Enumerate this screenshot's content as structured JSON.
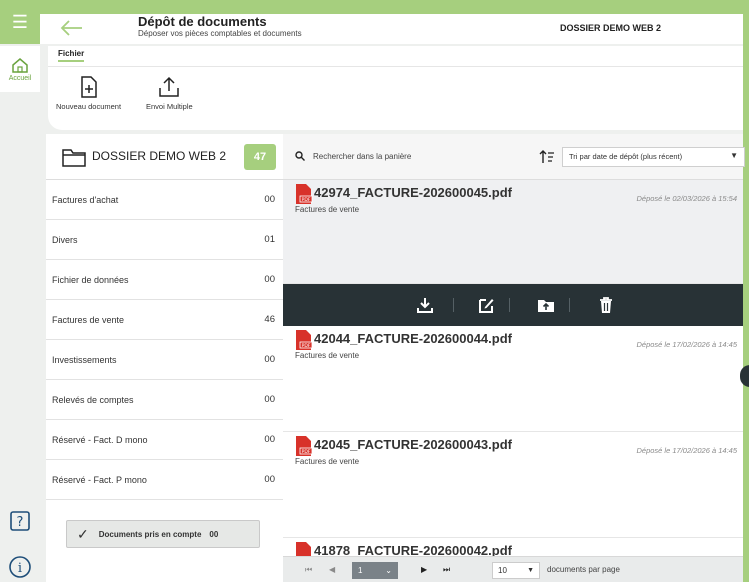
{
  "nav": {
    "home_label": "Accueil"
  },
  "header": {
    "title": "Dépôt de documents",
    "subtitle": "Déposer vos pièces comptables et documents",
    "folder": "DOSSIER DEMO WEB 2"
  },
  "ribbon": {
    "tab": "Fichier",
    "new_doc": "Nouveau document",
    "multi_upload": "Envoi Multiple"
  },
  "folder_panel": {
    "name": "DOSSIER DEMO WEB 2",
    "count": "47",
    "categories": [
      {
        "label": "Factures d'achat",
        "count": "00"
      },
      {
        "label": "Divers",
        "count": "01"
      },
      {
        "label": "Fichier de données",
        "count": "00"
      },
      {
        "label": "Factures de vente",
        "count": "46"
      },
      {
        "label": "Investissements",
        "count": "00"
      },
      {
        "label": "Relevés de comptes",
        "count": "00"
      },
      {
        "label": "Réservé - Fact. D mono",
        "count": "00"
      },
      {
        "label": "Réservé - Fact. P mono",
        "count": "00"
      }
    ],
    "taken_label": "Documents pris en compte",
    "taken_count": "00"
  },
  "docs": {
    "search": "Rechercher dans la panière",
    "sort": "Tri par date de dépôt (plus récent)",
    "items": [
      {
        "name": "42974_FACTURE-202600045.pdf",
        "category": "Factures de vente",
        "date": "Déposé le 02/03/2026 à 15:54"
      },
      {
        "name": "42044_FACTURE-202600044.pdf",
        "category": "Factures de vente",
        "date": "Déposé le 17/02/2026 à 14:45"
      },
      {
        "name": "42045_FACTURE-202600043.pdf",
        "category": "Factures de vente",
        "date": "Déposé le 17/02/2026 à 14:45"
      },
      {
        "name": "41878_FACTURE-202600042.pdf",
        "category": "",
        "date": ""
      }
    ]
  },
  "pager": {
    "page": "1",
    "page_size": "10",
    "per_page_label": "documents par page"
  },
  "colors": {
    "accent": "#a6cf7e",
    "dark_bar": "#283236",
    "pdf_red": "#d8322a"
  }
}
